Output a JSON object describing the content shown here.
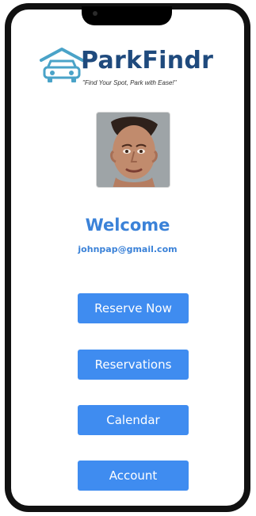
{
  "app": {
    "name": "ParkFindr",
    "tagline": "\"Find Your Spot, Park with Ease!\""
  },
  "profile": {
    "welcome": "Welcome",
    "email": "johnpap@gmail.com"
  },
  "actions": [
    {
      "label": "Reserve Now"
    },
    {
      "label": "Reservations"
    },
    {
      "label": "Calendar"
    },
    {
      "label": "Account"
    }
  ],
  "colors": {
    "primary": "#3f8cf0",
    "accent": "#3b82d8",
    "brand": "#1f4a7d",
    "frame": "#111111"
  },
  "icons": {
    "logo": "car-garage-icon",
    "avatar": "user-photo"
  }
}
